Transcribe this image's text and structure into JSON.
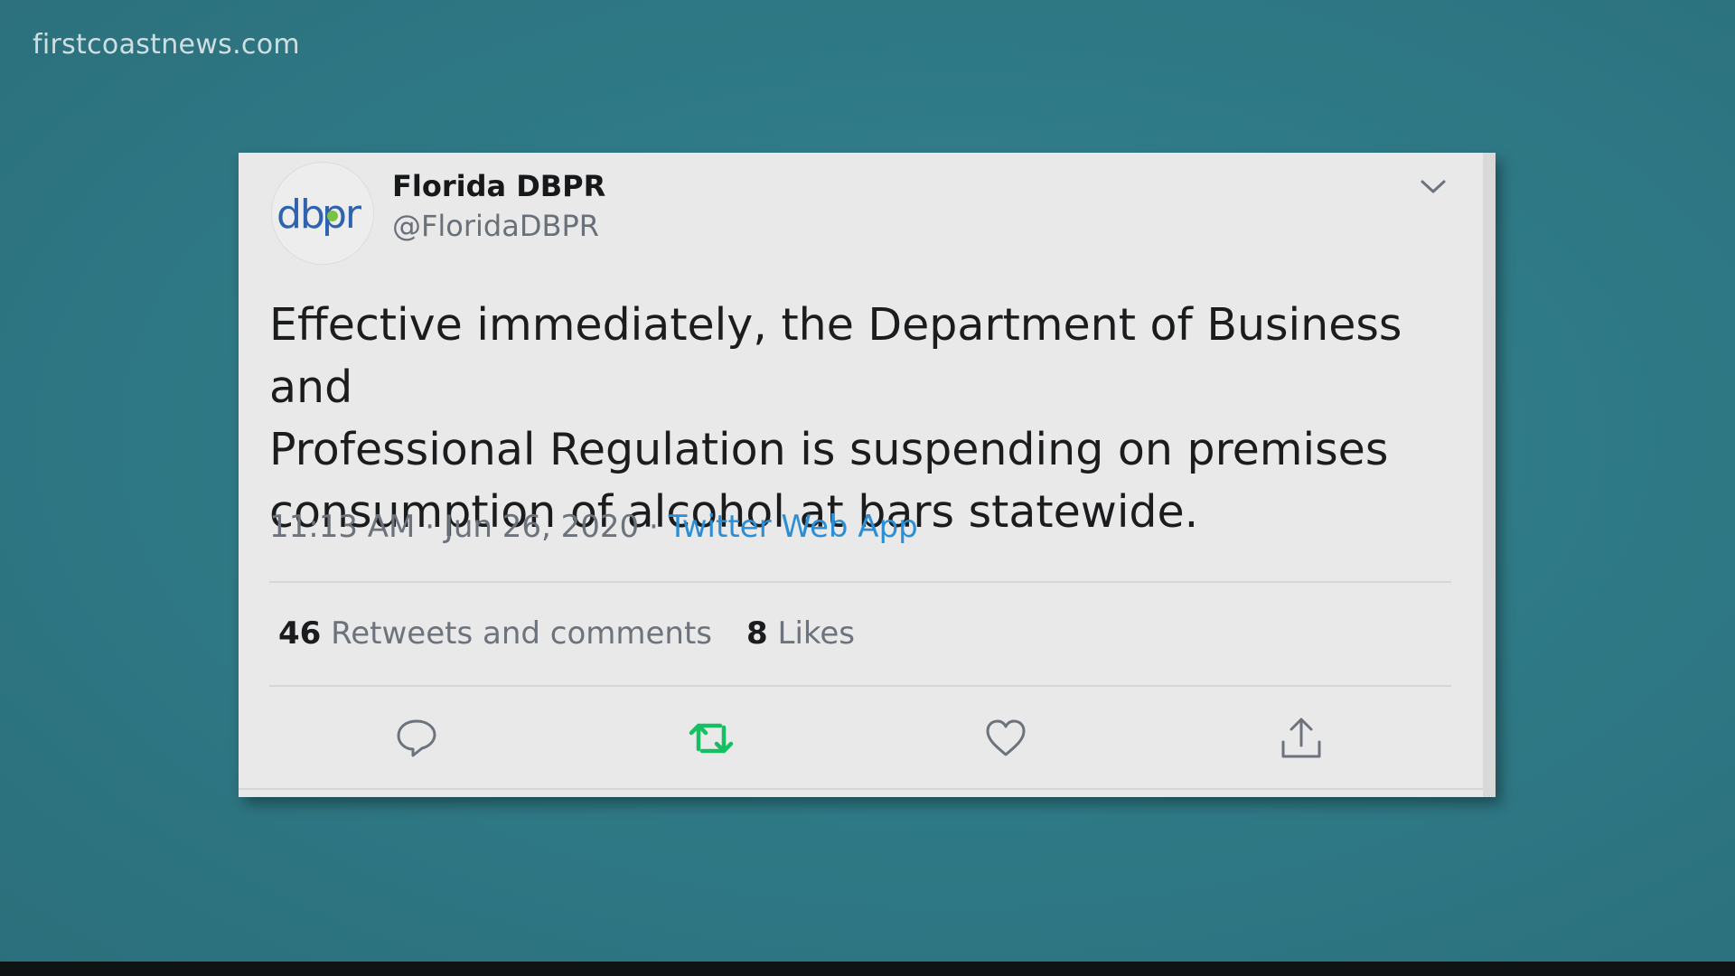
{
  "watermark": "firstcoastnews.com",
  "tweet": {
    "avatar_text": "dbpr",
    "display_name": "Florida DBPR",
    "handle": "@FloridaDBPR",
    "text": "Effective immediately, the Department of Business and\nProfessional Regulation is suspending on premises\nconsumption of alcohol at bars statewide.",
    "time": "11:13 AM",
    "separator": "·",
    "date": "Jun 26, 2020",
    "source": "Twitter Web App",
    "retweets_count": "46",
    "retweets_label": "Retweets and comments",
    "likes_count": "8",
    "likes_label": "Likes"
  },
  "icons": {
    "reply": "reply-icon",
    "retweet": "retweet-icon",
    "like": "heart-icon",
    "share": "share-icon",
    "menu": "chevron-down-icon"
  },
  "colors": {
    "background": "#2f7a87",
    "card": "#e9e9e9",
    "link": "#2a8fd6",
    "retweet_active": "#17bf63",
    "logo_blue": "#2f63b0",
    "logo_green": "#7cc242"
  }
}
